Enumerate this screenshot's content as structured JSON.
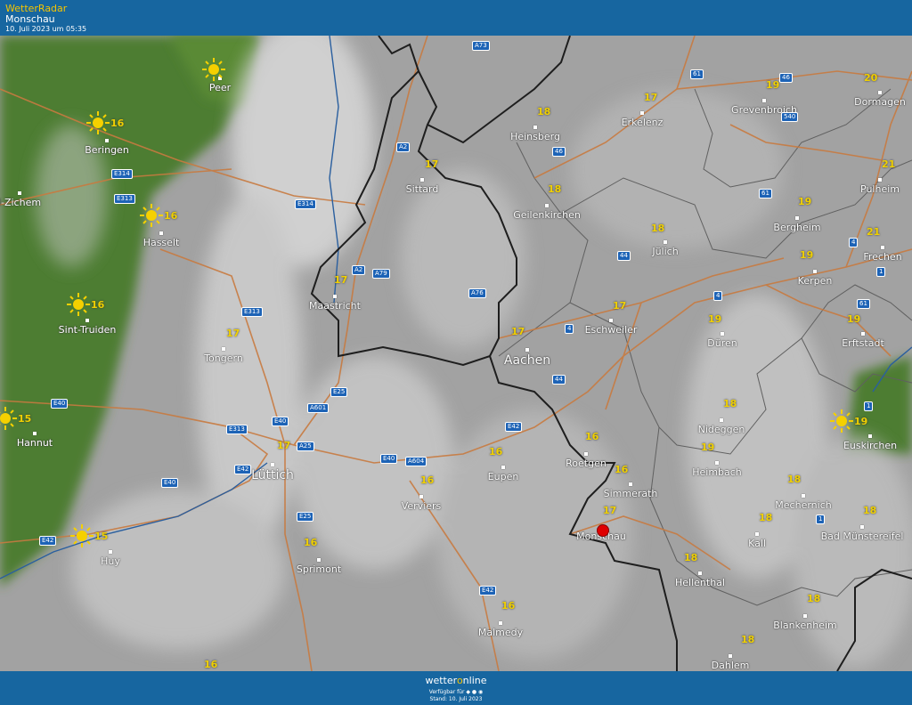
{
  "header": {
    "brand": "WetterRadar",
    "location": "Monschau",
    "timestamp": "10. Juli 2023 um 05:35"
  },
  "map": {
    "cities": [
      {
        "name": "Peer",
        "temp": ""
      },
      {
        "name": "Beringen",
        "temp": "16"
      },
      {
        "name": "l-Zichem",
        "temp": ""
      },
      {
        "name": "Hasselt",
        "temp": "16"
      },
      {
        "name": "Sint-Truiden",
        "temp": "16"
      },
      {
        "name": "Tongern",
        "temp": "17"
      },
      {
        "name": "Hannut",
        "temp": "15"
      },
      {
        "name": "Huy",
        "temp": "15"
      },
      {
        "name": "Lüttich",
        "temp": "17"
      },
      {
        "name": "Maastricht",
        "temp": "17"
      },
      {
        "name": "Sittard",
        "temp": "17"
      },
      {
        "name": "Heinsberg",
        "temp": "18"
      },
      {
        "name": "Erkelenz",
        "temp": "17"
      },
      {
        "name": "Grevenbroich",
        "temp": "19"
      },
      {
        "name": "Dormagen",
        "temp": "20"
      },
      {
        "name": "Geilenkirchen",
        "temp": "18"
      },
      {
        "name": "Pulheim",
        "temp": "21"
      },
      {
        "name": "Bergheim",
        "temp": "19"
      },
      {
        "name": "Jülich",
        "temp": "18"
      },
      {
        "name": "Frechen",
        "temp": "21"
      },
      {
        "name": "Kerpen",
        "temp": "19"
      },
      {
        "name": "Eschweiler",
        "temp": "17"
      },
      {
        "name": "Aachen",
        "temp": "17"
      },
      {
        "name": "Düren",
        "temp": "19"
      },
      {
        "name": "Erftstadt",
        "temp": "19"
      },
      {
        "name": "Nideggen",
        "temp": "18"
      },
      {
        "name": "Euskirchen",
        "temp": "19"
      },
      {
        "name": "Roetgen",
        "temp": "16"
      },
      {
        "name": "Eupen",
        "temp": "16"
      },
      {
        "name": "Heimbach",
        "temp": "19"
      },
      {
        "name": "Simmerath",
        "temp": "16"
      },
      {
        "name": "Verviers",
        "temp": "16"
      },
      {
        "name": "Monschau",
        "temp": "17"
      },
      {
        "name": "Mechernich",
        "temp": "18"
      },
      {
        "name": "Kall",
        "temp": "18"
      },
      {
        "name": "Bad Münstereifel",
        "temp": "18"
      },
      {
        "name": "Sprimont",
        "temp": "16"
      },
      {
        "name": "Hellenthal",
        "temp": "18"
      },
      {
        "name": "Malmedy",
        "temp": "16"
      },
      {
        "name": "Blankenheim",
        "temp": "18"
      },
      {
        "name": "Dahlem",
        "temp": "18"
      },
      {
        "name": "",
        "temp": "16"
      }
    ],
    "roads": [
      "A73",
      "61",
      "46",
      "540",
      "A2",
      "46",
      "E314",
      "E313",
      "E314",
      "A2",
      "A79",
      "61",
      "4",
      "44",
      "1",
      "A76",
      "4",
      "61",
      "E313",
      "4",
      "44",
      "E25",
      "A601",
      "E40",
      "E313",
      "E40",
      "A25",
      "E40",
      "E42",
      "A604",
      "E42",
      "E40",
      "1",
      "E25",
      "E42",
      "1",
      "E42"
    ],
    "marker_location": "Monschau"
  },
  "footer": {
    "logo_pre": "wetter",
    "logo_o": "o",
    "logo_post": "nline",
    "available": "Verfügbar für ◆ ● ◉",
    "stamp": "Stand: 10. Juli 2023"
  }
}
